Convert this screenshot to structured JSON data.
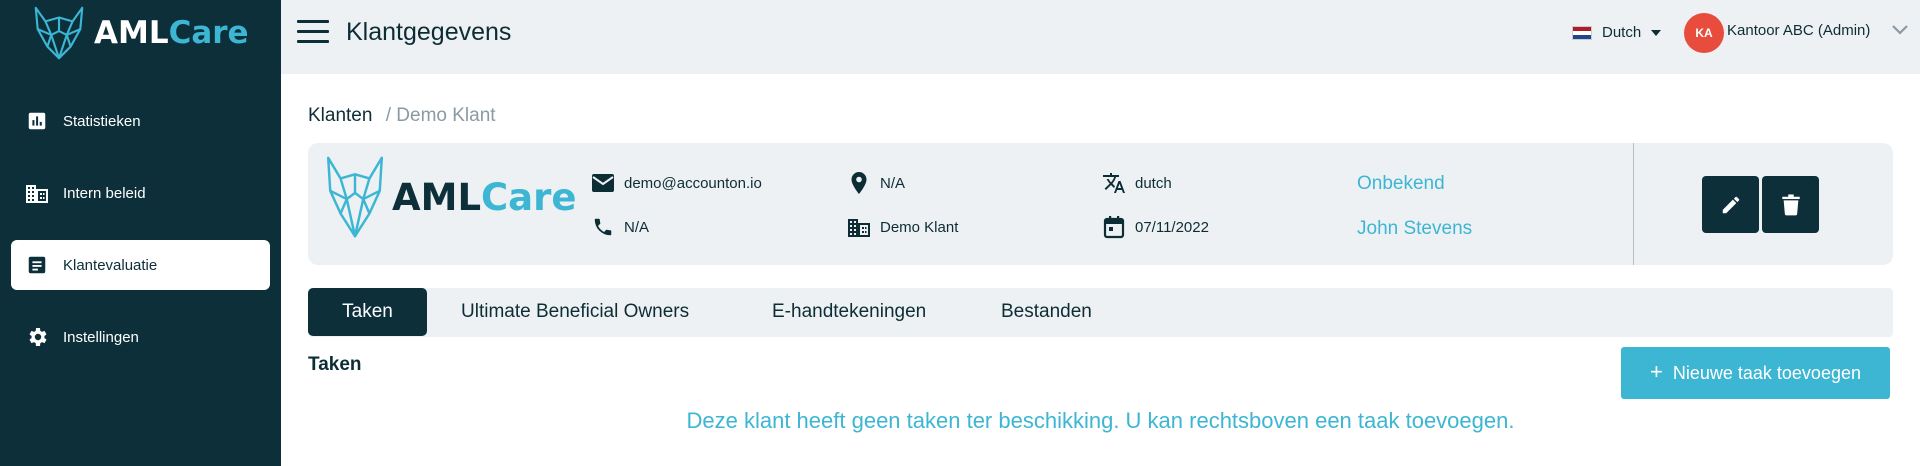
{
  "brand": {
    "name_part1": "AML",
    "name_part2": "Care"
  },
  "sidebar": {
    "items": [
      {
        "label": "Statistieken",
        "icon": "bar-chart-icon"
      },
      {
        "label": "Intern beleid",
        "icon": "building-icon"
      },
      {
        "label": "Klantevaluatie",
        "icon": "document-icon",
        "active": true
      },
      {
        "label": "Instellingen",
        "icon": "gear-icon"
      }
    ]
  },
  "header": {
    "title": "Klantgegevens",
    "language": "Dutch",
    "avatar_initials": "KA",
    "account": "Kantoor ABC (Admin)"
  },
  "breadcrumb": {
    "root": "Klanten",
    "separator": "/",
    "current": "Demo Klant"
  },
  "client": {
    "email": "demo@accounton.io",
    "phone": "N/A",
    "location": "N/A",
    "company": "Demo Klant",
    "language": "dutch",
    "date": "07/11/2022",
    "risk": "Onbekend",
    "contact": "John Stevens"
  },
  "tabs": [
    {
      "label": "Taken",
      "active": true
    },
    {
      "label": "Ultimate Beneficial Owners"
    },
    {
      "label": "E-handtekeningen"
    },
    {
      "label": "Bestanden"
    }
  ],
  "tasks": {
    "title": "Taken",
    "add_label": "Nieuwe taak toevoegen",
    "empty_message": "Deze klant heeft geen taken ter beschikking. U kan rechtsboven een taak toevoegen."
  },
  "colors": {
    "sidebar": "#0c2f3a",
    "accent": "#3cb6d3",
    "avatar": "#e74c3c",
    "panel": "#eef1f4"
  }
}
